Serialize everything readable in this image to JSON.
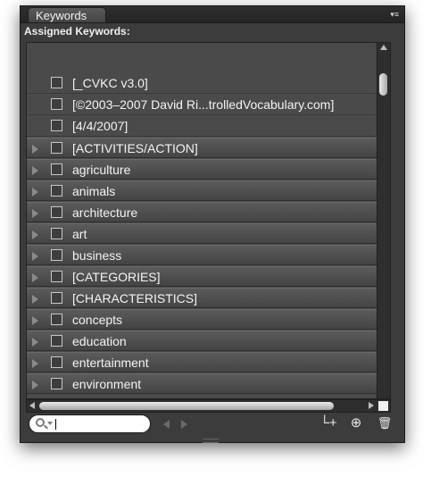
{
  "panel": {
    "tab_label": "Keywords",
    "menu_glyph": "▾≡",
    "assigned_label": "Assigned Keywords:"
  },
  "keywords": [
    {
      "label": "[_CVKC v3.0]",
      "expandable": false
    },
    {
      "label": "[©2003–2007 David Ri...trolledVocabulary.com]",
      "expandable": false
    },
    {
      "label": "[4/4/2007]",
      "expandable": false
    },
    {
      "label": "[ACTIVITIES/ACTION]",
      "expandable": true
    },
    {
      "label": "agriculture",
      "expandable": true
    },
    {
      "label": "animals",
      "expandable": true
    },
    {
      "label": "architecture",
      "expandable": true
    },
    {
      "label": "art",
      "expandable": true
    },
    {
      "label": "business",
      "expandable": true
    },
    {
      "label": "[CATEGORIES]",
      "expandable": true
    },
    {
      "label": "[CHARACTERISTICS]",
      "expandable": true
    },
    {
      "label": "concepts",
      "expandable": true
    },
    {
      "label": "education",
      "expandable": true
    },
    {
      "label": "entertainment",
      "expandable": true
    },
    {
      "label": "environment",
      "expandable": true
    }
  ],
  "search": {
    "value": "",
    "placeholder": ""
  },
  "toolbar": {
    "new_subkeyword_glyph": "└+",
    "new_keyword_glyph": "⊕",
    "delete_glyph": "🗑"
  },
  "icons": [
    "search-icon",
    "disclosure-triangle-icon",
    "checkbox-icon",
    "new-sub-keyword-icon",
    "new-keyword-icon",
    "delete-keyword-icon"
  ],
  "colors": {
    "panel_bg": "#3c3c3c",
    "row_bg": "#4a4a4a",
    "text": "#f4f4f4"
  }
}
